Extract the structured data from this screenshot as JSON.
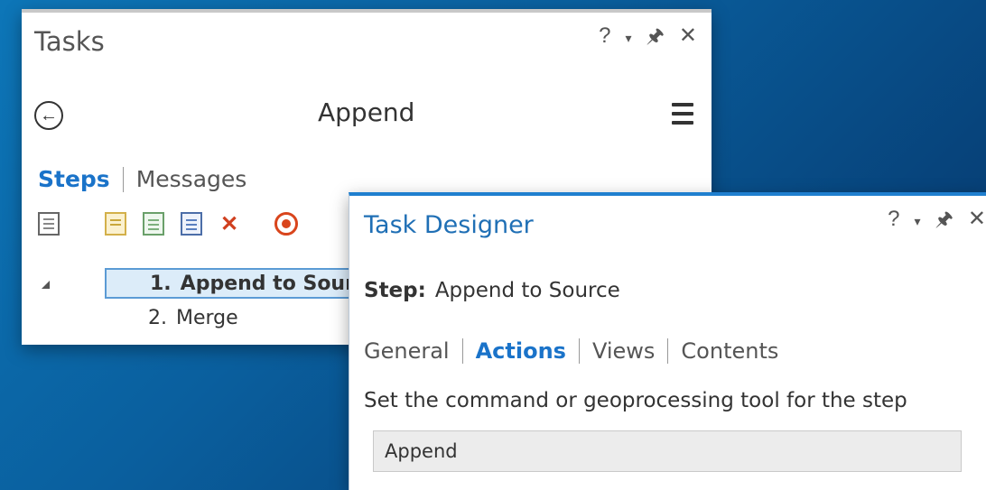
{
  "tasks_pane": {
    "title": "Tasks",
    "controls": {
      "help": "?",
      "options": "▾",
      "pin": "ᵖ",
      "close": "✕"
    },
    "task_name": "Append",
    "tabs": [
      {
        "label": "Steps",
        "active": true
      },
      {
        "label": "Messages",
        "active": false
      }
    ],
    "toolbar_icons": [
      "task-properties-icon",
      "new-step-icon",
      "new-step-check-icon",
      "step-properties-icon",
      "delete-icon",
      "record-icon"
    ],
    "steps": [
      {
        "number": "1.",
        "label": "Append to Sour",
        "selected": true
      },
      {
        "number": "2.",
        "label": "Merge",
        "selected": false
      }
    ]
  },
  "designer_pane": {
    "title": "Task Designer",
    "controls": {
      "help": "?",
      "options": "▾",
      "pin": "ᵖ",
      "close": "✕"
    },
    "step_label": "Step:",
    "step_value": "Append to Source",
    "tabs": [
      {
        "label": "General",
        "active": false
      },
      {
        "label": "Actions",
        "active": true
      },
      {
        "label": "Views",
        "active": false
      },
      {
        "label": "Contents",
        "active": false
      }
    ],
    "instruction": "Set the command or geoprocessing tool for the step",
    "command_value": "Append"
  },
  "colors": {
    "accent_blue": "#1a73c9",
    "selection_fill": "#dcecf9",
    "delete_red": "#d0401f",
    "background_blue": "#0a5f9e"
  }
}
